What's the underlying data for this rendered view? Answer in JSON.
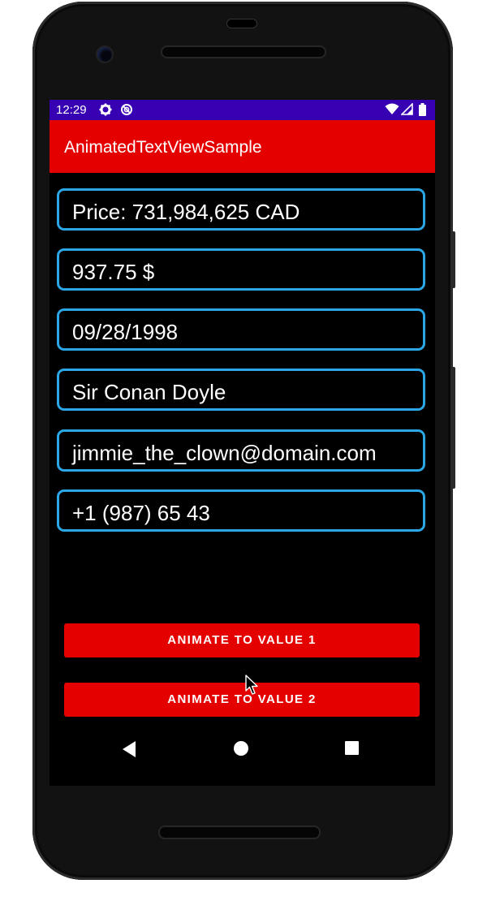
{
  "status_bar": {
    "time": "12:29",
    "left_icons": [
      "settings-icon",
      "dnd-icon"
    ],
    "right_icons": [
      "wifi-icon",
      "signal-icon",
      "battery-icon"
    ],
    "color": "#3700b3"
  },
  "app_bar": {
    "title": "AnimatedTextViewSample",
    "color": "#e50000"
  },
  "fields": [
    {
      "value": "Price: 731,984,625 CAD"
    },
    {
      "value": "937.75 $"
    },
    {
      "value": "09/28/1998"
    },
    {
      "value": "Sir Conan Doyle"
    },
    {
      "value": "jimmie_the_clown@domain.com"
    },
    {
      "value": "+1 (987) 65 43"
    }
  ],
  "field_border_color": "#2ba7e6",
  "buttons": {
    "animate1": "ANIMATE TO VALUE 1",
    "animate2": "ANIMATE TO VALUE 2",
    "color": "#e50000"
  },
  "nav_bar": {
    "icons": [
      "back-icon",
      "home-icon",
      "recents-icon"
    ]
  }
}
